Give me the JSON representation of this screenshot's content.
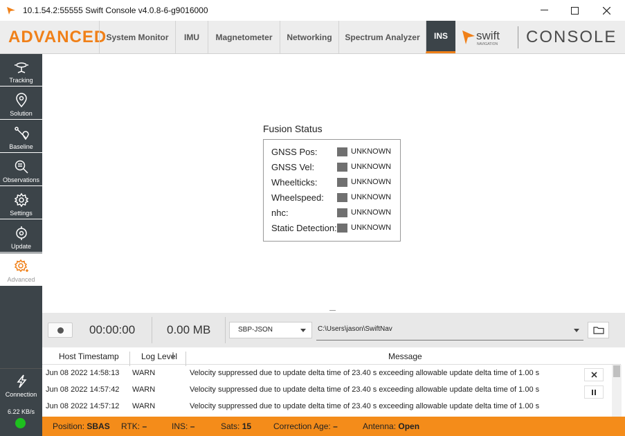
{
  "window": {
    "title": "10.1.54.2:55555 Swift Console v4.0.8-6-g9016000"
  },
  "header": {
    "section_title": "ADVANCED",
    "tabs": [
      {
        "label": "System Monitor"
      },
      {
        "label": "IMU"
      },
      {
        "label": "Magnetometer"
      },
      {
        "label": "Networking"
      },
      {
        "label": "Spectrum Analyzer"
      },
      {
        "label": "INS"
      }
    ],
    "active_tab": "INS",
    "logo_text": "swift",
    "logo_subtext": "NAVIGATION",
    "console_label": "CONSOLE"
  },
  "sidebar": {
    "items": [
      {
        "label": "Tracking",
        "icon": "satellite-dish-icon"
      },
      {
        "label": "Solution",
        "icon": "location-pin-icon"
      },
      {
        "label": "Baseline",
        "icon": "baseline-icon"
      },
      {
        "label": "Observations",
        "icon": "observations-icon"
      },
      {
        "label": "Settings",
        "icon": "gear-icon"
      },
      {
        "label": "Update",
        "icon": "update-icon"
      },
      {
        "label": "Advanced",
        "icon": "advanced-gear-icon"
      }
    ],
    "active": "Advanced",
    "connection_label": "Connection",
    "data_rate": "6.22 KB/s"
  },
  "fusion": {
    "title": "Fusion Status",
    "rows": [
      {
        "label": "GNSS Pos:",
        "status": "UNKNOWN"
      },
      {
        "label": "GNSS Vel:",
        "status": "UNKNOWN"
      },
      {
        "label": "Wheelticks:",
        "status": "UNKNOWN"
      },
      {
        "label": "Wheelspeed:",
        "status": "UNKNOWN"
      },
      {
        "label": "nhc:",
        "status": "UNKNOWN"
      },
      {
        "label": "Static Detection:",
        "status": "UNKNOWN"
      }
    ]
  },
  "recorder": {
    "timer": "00:00:00",
    "file_size": "0.00 MB",
    "format": "SBP-JSON",
    "path": "C:\\Users\\jason\\SwiftNav"
  },
  "log": {
    "columns": [
      "Host Timestamp",
      "Log Level",
      "Message"
    ],
    "rows": [
      {
        "timestamp": "Jun 08 2022 14:58:13",
        "level": "WARN",
        "message": "Velocity suppressed due to update delta time of 23.40 s exceeding allowable update delta time of 1.00 s"
      },
      {
        "timestamp": "Jun 08 2022 14:57:42",
        "level": "WARN",
        "message": "Velocity suppressed due to update delta time of 23.40 s exceeding allowable update delta time of 1.00 s"
      },
      {
        "timestamp": "Jun 08 2022 14:57:12",
        "level": "WARN",
        "message": "Velocity suppressed due to update delta time of 23.40 s exceeding allowable update delta time of 1.00 s"
      }
    ]
  },
  "status": {
    "position_label": "Position:",
    "position_value": "SBAS",
    "rtk_label": "RTK:",
    "rtk_value": "–",
    "ins_label": "INS:",
    "ins_value": "–",
    "sats_label": "Sats:",
    "sats_value": "15",
    "corr_label": "Correction Age:",
    "corr_value": "–",
    "antenna_label": "Antenna:",
    "antenna_value": "Open"
  },
  "colors": {
    "accent": "#f08018",
    "sidebar": "#3c4449",
    "status_bar": "#f48c1a",
    "led": "#1ec01e"
  }
}
